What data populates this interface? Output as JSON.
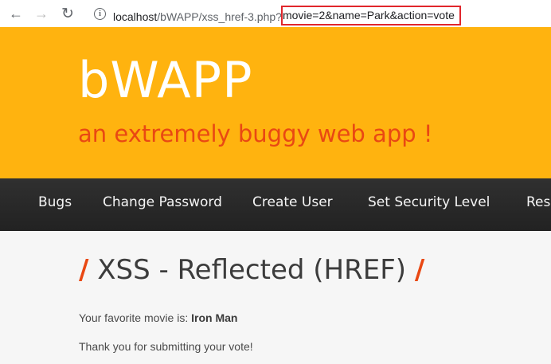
{
  "browser": {
    "back_icon": "←",
    "forward_icon": "→",
    "reload_icon": "↻",
    "info_icon": "i",
    "url_host": "localhost",
    "url_path": "/bWAPP/xss_href-3.php?",
    "url_query": "movie=2&name=Park&action=vote",
    "highlight_color": "#e0262c"
  },
  "header": {
    "logo": "bWAPP",
    "tagline": "an extremely buggy web app !",
    "background_color": "#ffb30f",
    "tagline_color": "#e94813"
  },
  "menu": {
    "items": [
      "Bugs",
      "Change Password",
      "Create User",
      "Set Security Level",
      "Res"
    ]
  },
  "main": {
    "title_slash_left": "/",
    "title": "XSS - Reflected (HREF)",
    "title_slash_right": "/",
    "favorite_prefix": "Your favorite movie is: ",
    "favorite_movie": "Iron Man",
    "thanks": "Thank you for submitting your vote!"
  }
}
